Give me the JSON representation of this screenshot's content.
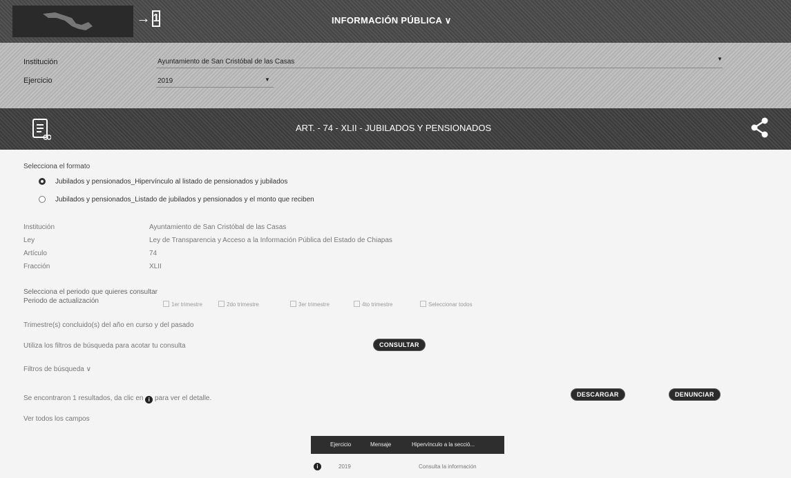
{
  "header": {
    "title": "INFORMACIÓN PÚBLICA",
    "title_caret": "∨",
    "login_icon_label": "1"
  },
  "filters": {
    "institucion_label": "Institución",
    "institucion_value": "Ayuntamiento de San Cristóbal de las Casas",
    "ejercicio_label": "Ejercicio",
    "ejercicio_value": "2019"
  },
  "section": {
    "title": "ART. - 74 - XLII - JUBILADOS Y PENSIONADOS"
  },
  "formato": {
    "label": "Selecciona el formato",
    "options": [
      "Jubilados y pensionados_Hipervínculo al listado de pensionados y jubilados",
      "Jubilados y pensionados_Listado de jubilados y pensionados y el monto que reciben"
    ],
    "selected_index": 0
  },
  "details": {
    "institucion_label": "Institución",
    "institucion_value": "Ayuntamiento de San Cristóbal de las Casas",
    "ley_label": "Ley",
    "ley_value": "Ley de Transparencia y Acceso a la Información Pública del Estado de Chiapas",
    "articulo_label": "Artículo",
    "articulo_value": "74",
    "fraccion_label": "Fracción",
    "fraccion_value": "XLII"
  },
  "periodo": {
    "prompt": "Selecciona el periodo que quieres consultar",
    "label": "Periodo de actualización",
    "options": [
      "1er trimestre",
      "2do trimestre",
      "3er trimestre",
      "4to trimestre",
      "Seleccionar todos"
    ],
    "note": "Trimestre(s) concluido(s) del año en curso y del pasado"
  },
  "consulta": {
    "hint": "Utiliza los filtros de búsqueda para acotar tu consulta",
    "button": "CONSULTAR",
    "filters_toggle": "Filtros de búsqueda ∨"
  },
  "results": {
    "summary_pre": "Se encontraron 1 resultados, da clic en",
    "summary_post": "para ver el detalle.",
    "download_button": "DESCARGAR",
    "report_button": "DENUNCIAR",
    "view_all": "Ver todos los campos",
    "columns": [
      "Ejercicio",
      "Mensaje",
      "Hipervínculo a la secció..."
    ],
    "rows": [
      {
        "ejercicio": "2019",
        "hipervinculo": "Consulta la información"
      }
    ]
  }
}
